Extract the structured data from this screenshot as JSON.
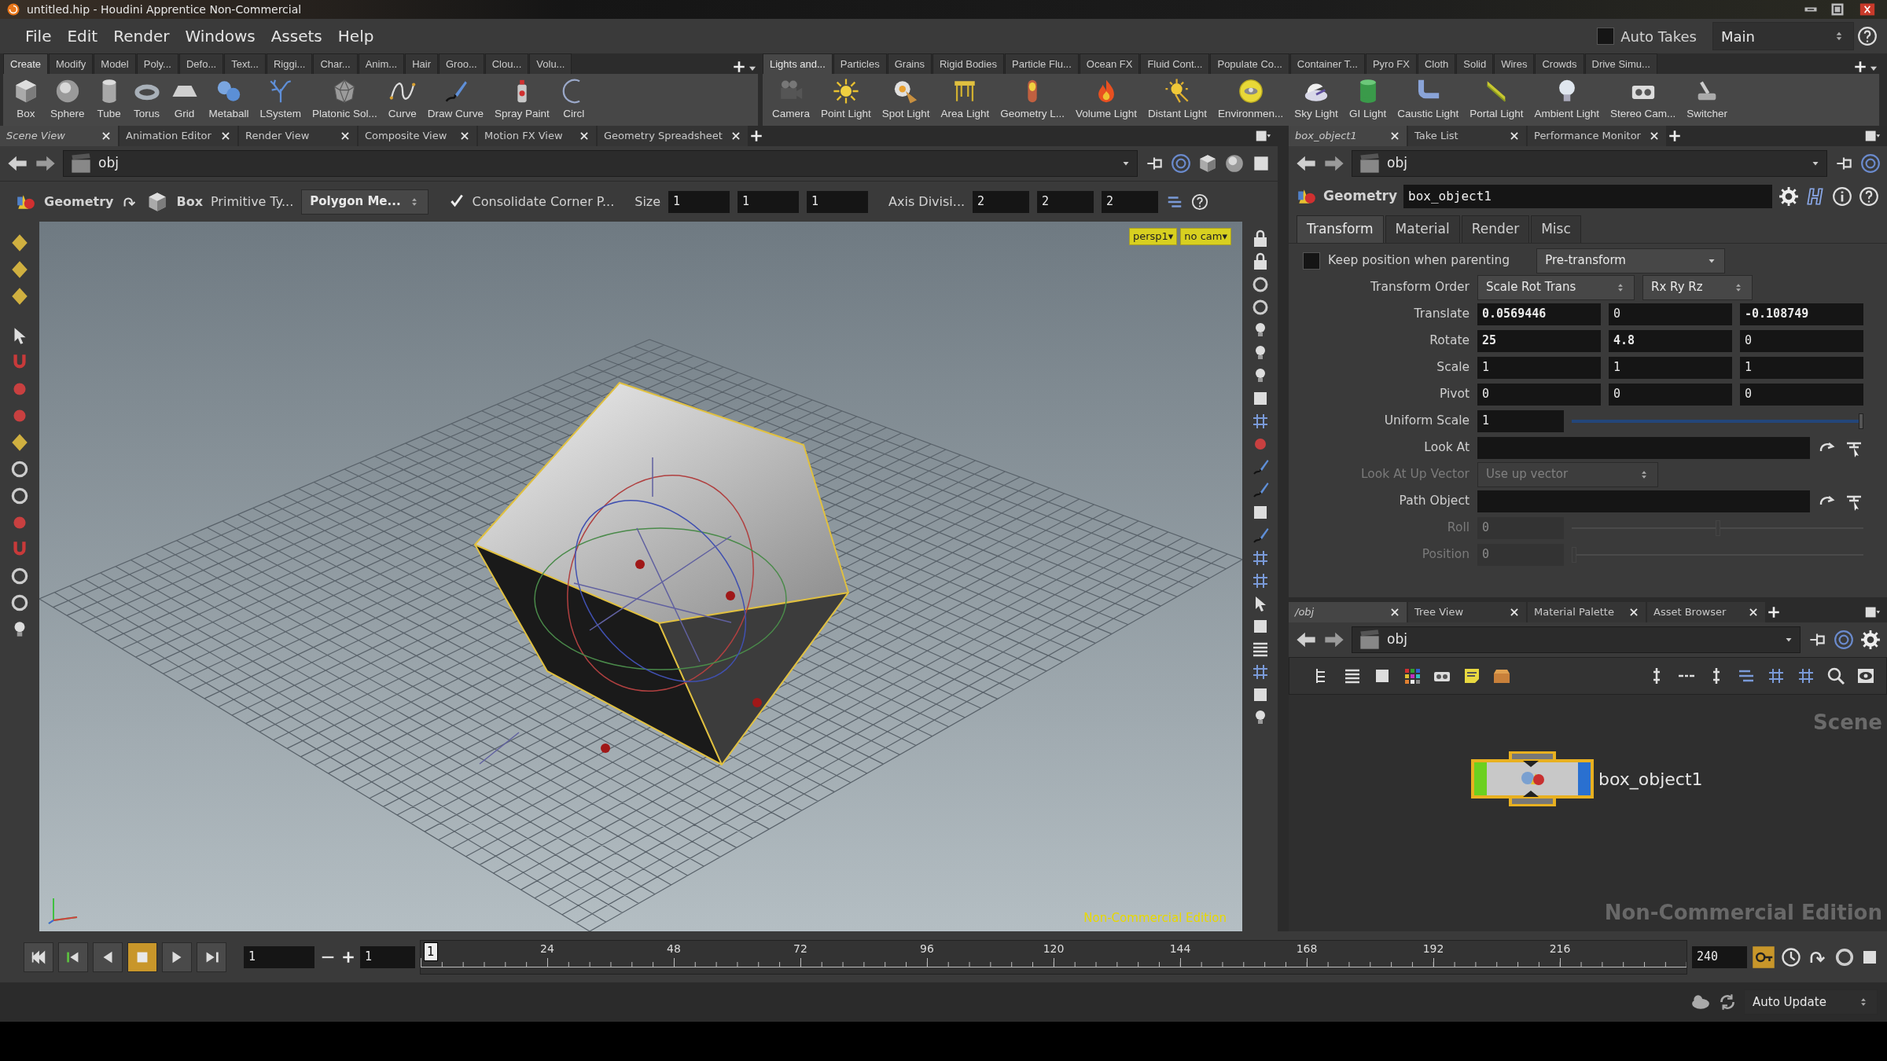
{
  "window": {
    "title": "untitled.hip - Houdini Apprentice Non-Commercial"
  },
  "menu": [
    "File",
    "Edit",
    "Render",
    "Windows",
    "Assets",
    "Help"
  ],
  "auto_takes": {
    "label": "Auto Takes",
    "checked": false
  },
  "take_menu": "Main",
  "shelves": [
    {
      "tabs": [
        {
          "label": "Create",
          "selected": true
        },
        {
          "label": "Modify",
          "selected": false
        },
        {
          "label": "Model",
          "selected": false
        },
        {
          "label": "Poly...",
          "selected": false
        },
        {
          "label": "Defo...",
          "selected": false
        },
        {
          "label": "Text...",
          "selected": false
        },
        {
          "label": "Riggi...",
          "selected": false
        },
        {
          "label": "Char...",
          "selected": false
        },
        {
          "label": "Anim...",
          "selected": false
        },
        {
          "label": "Hair",
          "selected": false
        },
        {
          "label": "Groo...",
          "selected": false
        },
        {
          "label": "Clou...",
          "selected": false
        },
        {
          "label": "Volu...",
          "selected": false
        }
      ],
      "tools": [
        "Box",
        "Sphere",
        "Tube",
        "Torus",
        "Grid",
        "Metaball",
        "LSystem",
        "Platonic Sol...",
        "Curve",
        "Draw Curve",
        "Spray Paint",
        "Circl"
      ]
    },
    {
      "tabs": [
        {
          "label": "Lights and...",
          "selected": true
        },
        {
          "label": "Particles",
          "selected": false
        },
        {
          "label": "Grains",
          "selected": false
        },
        {
          "label": "Rigid Bodies",
          "selected": false
        },
        {
          "label": "Particle Flu...",
          "selected": false
        },
        {
          "label": "Ocean FX",
          "selected": false
        },
        {
          "label": "Fluid Cont...",
          "selected": false
        },
        {
          "label": "Populate Co...",
          "selected": false
        },
        {
          "label": "Container T...",
          "selected": false
        },
        {
          "label": "Pyro FX",
          "selected": false
        },
        {
          "label": "Cloth",
          "selected": false
        },
        {
          "label": "Solid",
          "selected": false
        },
        {
          "label": "Wires",
          "selected": false
        },
        {
          "label": "Crowds",
          "selected": false
        },
        {
          "label": "Drive Simu...",
          "selected": false
        }
      ],
      "tools": [
        "Camera",
        "Point Light",
        "Spot Light",
        "Area Light",
        "Geometry L...",
        "Volume Light",
        "Distant Light",
        "Environmen...",
        "Sky Light",
        "GI Light",
        "Caustic Light",
        "Portal Light",
        "Ambient Light",
        "Stereo Cam...",
        "Switcher"
      ]
    }
  ],
  "scene_pane": {
    "tabs": [
      {
        "label": "Scene View",
        "selected": true
      },
      {
        "label": "Animation Editor",
        "selected": false
      },
      {
        "label": "Render View",
        "selected": false
      },
      {
        "label": "Composite View",
        "selected": false
      },
      {
        "label": "Motion FX View",
        "selected": false
      },
      {
        "label": "Geometry Spreadsheet",
        "selected": false
      }
    ],
    "path": "obj",
    "op_toolbar": {
      "context": "Geometry",
      "node": "Box",
      "primitive_label": "Primitive Ty...",
      "primitive_menu": "Polygon Me...",
      "consolidate": {
        "label": "Consolidate Corner P...",
        "checked": true
      },
      "size_label": "Size",
      "size": [
        "1",
        "1",
        "1"
      ],
      "divisions_label": "Axis Divisi...",
      "divisions": [
        "2",
        "2",
        "2"
      ]
    },
    "viewport": {
      "camera_menu": "persp1▾",
      "display_menu": "no cam▾",
      "edition": "Non-Commercial Edition"
    }
  },
  "param_pane": {
    "tabs": [
      {
        "label": "box_object1",
        "selected": true
      },
      {
        "label": "Take List",
        "selected": false
      },
      {
        "label": "Performance Monitor",
        "selected": false
      }
    ],
    "path": "obj",
    "node_type": "Geometry",
    "node_name": "box_object1",
    "folders": [
      {
        "label": "Transform",
        "selected": true
      },
      {
        "label": "Material",
        "selected": false
      },
      {
        "label": "Render",
        "selected": false
      },
      {
        "label": "Misc",
        "selected": false
      }
    ],
    "rows": [
      {
        "kind": "toggle",
        "label": "Keep position when parenting",
        "checked": false,
        "menu": "Pre-transform",
        "disabled": false
      },
      {
        "kind": "menus",
        "label": "Transform Order",
        "menus": [
          "Scale Rot Trans",
          "Rx Ry Rz"
        ],
        "disabled": false
      },
      {
        "kind": "vector",
        "label": "Translate",
        "values": [
          {
            "text": "0.0569446",
            "changed": true
          },
          {
            "text": "0",
            "changed": false
          },
          {
            "text": "-0.108749",
            "changed": true
          }
        ],
        "disabled": false
      },
      {
        "kind": "vector",
        "label": "Rotate",
        "values": [
          {
            "text": "25",
            "changed": true
          },
          {
            "text": "4.8",
            "changed": true
          },
          {
            "text": "0",
            "changed": false
          }
        ],
        "disabled": false
      },
      {
        "kind": "vector",
        "label": "Scale",
        "values": [
          {
            "text": "1",
            "changed": false
          },
          {
            "text": "1",
            "changed": false
          },
          {
            "text": "1",
            "changed": false
          }
        ],
        "disabled": false
      },
      {
        "kind": "vector",
        "label": "Pivot",
        "values": [
          {
            "text": "0",
            "changed": false
          },
          {
            "text": "0",
            "changed": false
          },
          {
            "text": "0",
            "changed": false
          }
        ],
        "disabled": false
      },
      {
        "kind": "slider",
        "label": "Uniform Scale",
        "value": "1",
        "level": 1,
        "disabled": false
      },
      {
        "kind": "path",
        "label": "Look At",
        "disabled": false
      },
      {
        "kind": "menu",
        "label": "Look At Up Vector",
        "menu": "Use up vector",
        "disabled": true
      },
      {
        "kind": "path",
        "label": "Path Object",
        "disabled": false
      },
      {
        "kind": "slider",
        "label": "Roll",
        "value": "0",
        "level": 0.5,
        "disabled": true
      },
      {
        "kind": "slider",
        "label": "Position",
        "value": "0",
        "level": 0,
        "disabled": true
      }
    ]
  },
  "network_pane": {
    "tabs": [
      {
        "label": "/obj",
        "selected": true
      },
      {
        "label": "Tree View",
        "selected": false
      },
      {
        "label": "Material Palette",
        "selected": false
      },
      {
        "label": "Asset Browser",
        "selected": false
      }
    ],
    "path": "obj",
    "node": {
      "name": "box_object1",
      "selected": true
    },
    "context_label": "Scene",
    "edition": "Non-Commercial Edition"
  },
  "timeline": {
    "transport": [
      {
        "kind": "first",
        "selected": false
      },
      {
        "kind": "step-back",
        "selected": false
      },
      {
        "kind": "reverse",
        "selected": false
      },
      {
        "kind": "stop",
        "selected": true
      },
      {
        "kind": "play",
        "selected": false
      },
      {
        "kind": "last",
        "selected": false
      }
    ],
    "current_frame": "1",
    "step": "1",
    "marker": "1",
    "ticks": [
      "24",
      "48",
      "72",
      "96",
      "120",
      "144",
      "168",
      "192",
      "216"
    ],
    "end_frame": "240"
  },
  "status_bar": {
    "update_menu": "Auto Update"
  }
}
